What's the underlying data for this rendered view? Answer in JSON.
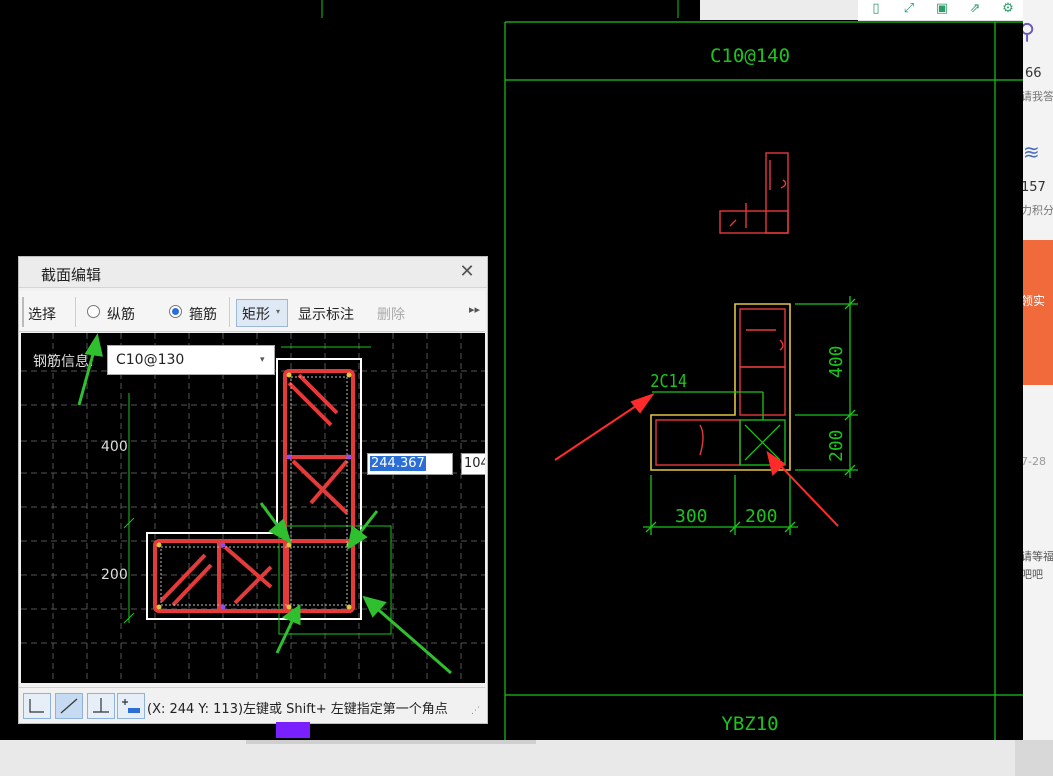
{
  "drawing": {
    "top_label": "C10@140",
    "bottom_label": "YBZ10",
    "rebar_label": "2C14",
    "dim_400": "400",
    "dim_200": "200",
    "dim_300": "300",
    "dim_200b": "200"
  },
  "web": {
    "count1": "66",
    "text1": "请我答",
    "count2": "157",
    "text2": "力积分",
    "date": "7-28",
    "text3": "请等福",
    "text4": "吧吧",
    "text5": "领实"
  },
  "dialog": {
    "title": "截面编辑",
    "toolbar": {
      "select": "选择",
      "longitudinal": "纵筋",
      "stirrup": "箍筋",
      "shape": "矩形",
      "show_dim": "显示标注",
      "delete": "删除"
    },
    "rebar_info_label": "钢筋信息:",
    "rebar_info_value": "C10@130",
    "canvas": {
      "dim_400": "400",
      "dim_200": "200"
    },
    "coord_x_value": "244.367",
    "coord_y_value": "104",
    "status": "(X: 244 Y: 113)左键或 Shift+ 左键指定第一个角点"
  }
}
